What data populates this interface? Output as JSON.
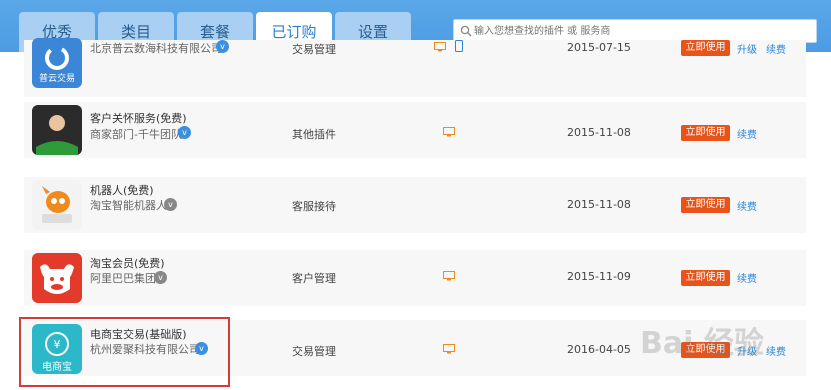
{
  "tabs": [
    {
      "label": "优秀"
    },
    {
      "label": "类目"
    },
    {
      "label": "套餐"
    },
    {
      "label": "已订购"
    },
    {
      "label": "设置"
    }
  ],
  "search": {
    "placeholder": "输入您想查找的插件 或 服务商"
  },
  "rows": [
    {
      "name": "",
      "vendor": "北京普云数海科技有限公司",
      "icon_label": "普云交易",
      "category": "交易管理",
      "date": "2015-07-15",
      "use_label": "立即使用",
      "upgrade_label": "升级",
      "renew_label": "续费"
    },
    {
      "name": "客户关怀服务(免费)",
      "vendor": "商家部门-千牛团队",
      "category": "其他插件",
      "date": "2015-11-08",
      "use_label": "立即使用",
      "renew_label": "续费"
    },
    {
      "name": "机器人(免费)",
      "vendor": "淘宝智能机器人",
      "category": "客服接待",
      "date": "2015-11-08",
      "use_label": "立即使用",
      "renew_label": "续费"
    },
    {
      "name": "淘宝会员(免费)",
      "vendor": "阿里巴巴集团",
      "category": "客户管理",
      "date": "2015-11-09",
      "use_label": "立即使用",
      "renew_label": "续费"
    },
    {
      "name": "电商宝交易(基础版)",
      "vendor": "杭州爱聚科技有限公司",
      "icon_label": "电商宝",
      "category": "交易管理",
      "date": "2016-04-05",
      "use_label": "立即使用",
      "upgrade_label": "升级",
      "renew_label": "续费"
    }
  ],
  "badge": {
    "label": "v"
  },
  "watermark": {
    "text": "Bai 经验"
  },
  "colors": {
    "accent": "#4d9ce3",
    "use_button": "#e8531a",
    "link": "#2a86d8",
    "highlight": "#d43b3b"
  }
}
